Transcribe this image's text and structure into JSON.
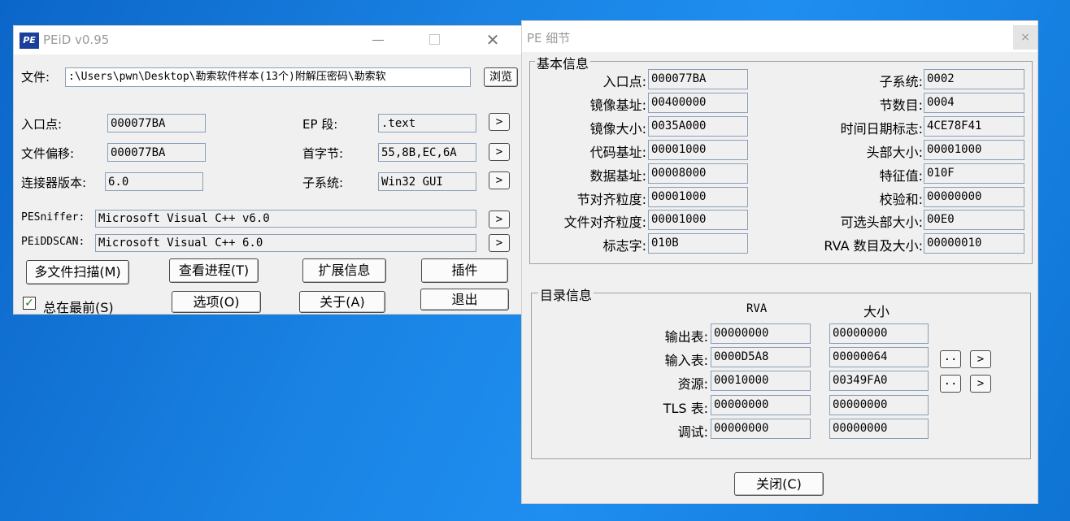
{
  "peid": {
    "title": "PEiD v0.95",
    "logo_text": "PE",
    "file_label": "文件:",
    "file_value": ":\\Users\\pwn\\Desktop\\勒索软件样本(13个)附解压密码\\勒索软",
    "browse_label": "浏览",
    "entry_label": "入口点:",
    "entry_value": "000077BA",
    "offset_label": "文件偏移:",
    "offset_value": "000077BA",
    "linker_label": "连接器版本:",
    "linker_value": "6.0",
    "ep_section_label": "EP 段:",
    "ep_section_value": ".text",
    "first_bytes_label": "首字节:",
    "first_bytes_value": "55,8B,EC,6A",
    "subsystem_label": "子系统:",
    "subsystem_value": "Win32 GUI",
    "arrow": ">",
    "pesniffer_label": "PESniffer:",
    "pesniffer_value": "Microsoft Visual C++ v6.0",
    "peiddscan_label": "PEiDDSCAN:",
    "peiddscan_value": "Microsoft Visual C++ 6.0",
    "buttons": {
      "multi_scan": "多文件扫描(M)",
      "task_viewer": "查看进程(T)",
      "extra_info": "扩展信息",
      "plugins": "插件",
      "options": "选项(O)",
      "about": "关于(A)",
      "exit": "退出"
    },
    "stay_on_top_label": "总在最前(S)",
    "stay_on_top_checked": true
  },
  "pe_details": {
    "title": "PE 细节",
    "close_x": "×",
    "basic_group_title": "基本信息",
    "basic_left": [
      {
        "label": "入口点:",
        "value": "000077BA"
      },
      {
        "label": "镜像基址:",
        "value": "00400000"
      },
      {
        "label": "镜像大小:",
        "value": "0035A000"
      },
      {
        "label": "代码基址:",
        "value": "00001000"
      },
      {
        "label": "数据基址:",
        "value": "00008000"
      },
      {
        "label": "节对齐粒度:",
        "value": "00001000"
      },
      {
        "label": "文件对齐粒度:",
        "value": "00001000"
      },
      {
        "label": "标志字:",
        "value": "010B"
      }
    ],
    "basic_right": [
      {
        "label": "子系统:",
        "value": "0002"
      },
      {
        "label": "节数目:",
        "value": "0004"
      },
      {
        "label": "时间日期标志:",
        "value": "4CE78F41"
      },
      {
        "label": "头部大小:",
        "value": "00001000"
      },
      {
        "label": "特征值:",
        "value": "010F"
      },
      {
        "label": "校验和:",
        "value": "00000000"
      },
      {
        "label": "可选头部大小:",
        "value": "00E0"
      },
      {
        "label": "RVA 数目及大小:",
        "value": "00000010"
      }
    ],
    "dir_group_title": "目录信息",
    "dir_col_rva": "RVA",
    "dir_col_size": "大小",
    "dir_rows": [
      {
        "label": "输出表:",
        "rva": "00000000",
        "size": "00000000"
      },
      {
        "label": "输入表:",
        "rva": "0000D5A8",
        "size": "00000064"
      },
      {
        "label": "资源:",
        "rva": "00010000",
        "size": "00349FA0"
      },
      {
        "label": "TLS 表:",
        "rva": "00000000",
        "size": "00000000"
      },
      {
        "label": "调试:",
        "rva": "00000000",
        "size": "00000000"
      }
    ],
    "dots_label": "..",
    "arrow": ">",
    "close_button": "关闭(C)"
  }
}
